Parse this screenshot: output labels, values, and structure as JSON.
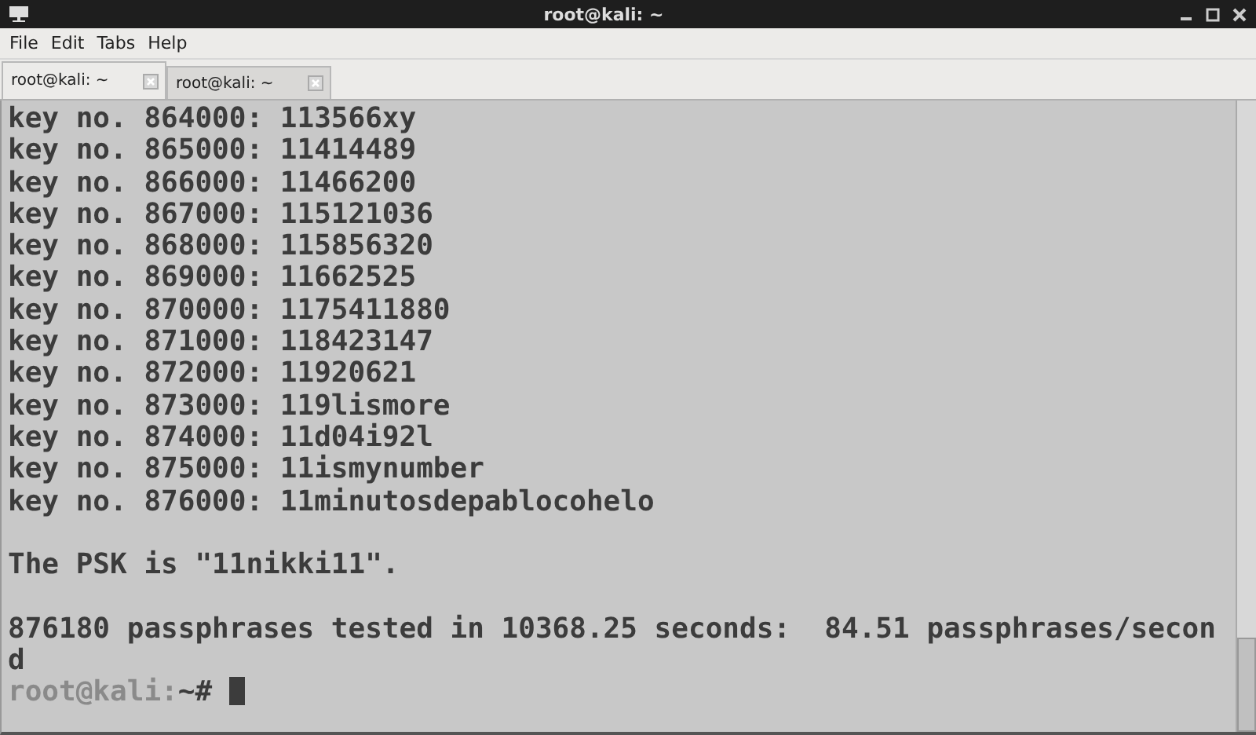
{
  "window": {
    "title": "root@kali: ~"
  },
  "menu": [
    {
      "label": "File"
    },
    {
      "label": "Edit"
    },
    {
      "label": "Tabs"
    },
    {
      "label": "Help"
    }
  ],
  "tabs": [
    {
      "label": "root@kali: ~",
      "selected": true
    },
    {
      "label": "root@kali: ~",
      "selected": false
    }
  ],
  "terminal": {
    "blocks": [
      [
        "key no. 864000: 113566xy",
        "key no. 865000: 11414489",
        "key no. 866000: 11466200",
        "key no. 867000: 115121036",
        "key no. 868000: 115856320",
        "key no. 869000: 11662525",
        "key no. 870000: 1175411880",
        "key no. 871000: 118423147",
        "key no. 872000: 11920621",
        "key no. 873000: 119lismore",
        "key no. 874000: 11d04i92l",
        "key no. 875000: 11ismynumber",
        "key no. 876000: 11minutosdepablocohelo"
      ],
      [
        "The PSK is \"11nikki11\"."
      ],
      [
        "876180 passphrases tested in 10368.25 seconds:  84.51 passphrases/second"
      ]
    ],
    "prompt": {
      "host": "root@kali:",
      "path": "~#"
    }
  }
}
